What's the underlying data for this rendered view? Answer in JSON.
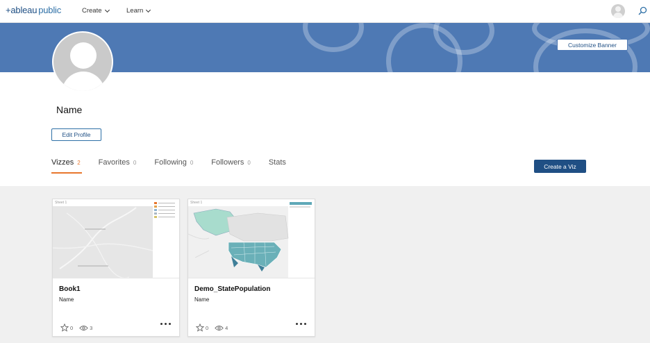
{
  "nav": {
    "logo_prefix": "+ableau",
    "logo_suffix": "public",
    "links": [
      {
        "label": "Create"
      },
      {
        "label": "Learn"
      }
    ]
  },
  "banner": {
    "customize_label": "Customize Banner",
    "color": "#4e79b4"
  },
  "profile": {
    "name": "Name",
    "edit_label": "Edit Profile"
  },
  "tabs": [
    {
      "label": "Vizzes",
      "count": "2"
    },
    {
      "label": "Favorites",
      "count": "0"
    },
    {
      "label": "Following",
      "count": "0"
    },
    {
      "label": "Followers",
      "count": "0"
    },
    {
      "label": "Stats",
      "count": ""
    }
  ],
  "create_viz_label": "Create a Viz",
  "accent": "#e8762d",
  "brand": "#1f4f84",
  "cards": [
    {
      "title": "Book1",
      "author": "Name",
      "favorites": "0",
      "views": "3",
      "sheet": "Sheet 1"
    },
    {
      "title": "Demo_StatePopulation",
      "author": "Name",
      "favorites": "0",
      "views": "4",
      "sheet": "Sheet 1"
    }
  ]
}
